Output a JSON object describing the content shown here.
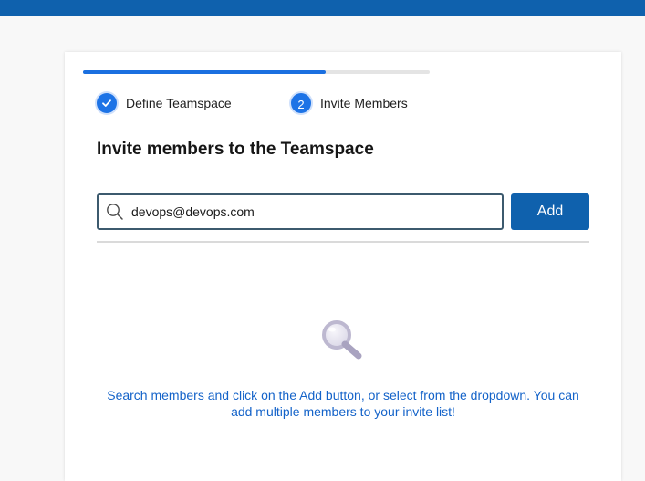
{
  "wizard": {
    "progress_percent": 70,
    "steps": [
      {
        "label": "Define Teamspace",
        "state": "completed",
        "icon": "check-icon"
      },
      {
        "label": "Invite Members",
        "state": "active",
        "number": "2"
      }
    ]
  },
  "main": {
    "title": "Invite members to the Teamspace",
    "search": {
      "value": "devops@devops.com",
      "placeholder": "",
      "icon": "search-icon"
    },
    "add_label": "Add",
    "empty_state": {
      "icon": "magnifier-illustration-icon",
      "message": "Search members and click on the Add button, or select from the dropdown. You can add multiple members to your invite list!"
    }
  },
  "colors": {
    "topbar": "#0f61ad",
    "accent": "#1d73e6",
    "button": "#0f61ad",
    "link_text": "#1463c9"
  }
}
